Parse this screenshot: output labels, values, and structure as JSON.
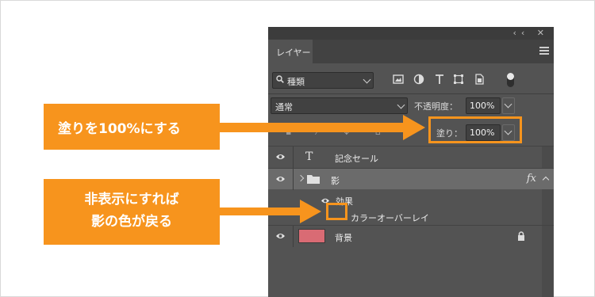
{
  "panel": {
    "tab_label": "レイヤー",
    "top_icons": "‹‹ ✕"
  },
  "filter": {
    "kind_label": "種類"
  },
  "blend": {
    "mode": "通常",
    "opacity_label": "不透明度：",
    "opacity_value": "100%",
    "fill_label": "塗り：",
    "fill_value": "100%"
  },
  "layers": [
    {
      "name": "記念セール",
      "type": "text",
      "visible": true
    },
    {
      "name": "影",
      "type": "group",
      "visible": true,
      "has_effects": true,
      "effects_badge": "fx"
    },
    {
      "name": "背景",
      "type": "background",
      "visible": true,
      "locked": true,
      "thumb_color": "#d96b74"
    }
  ],
  "effects": {
    "header": "効果",
    "items": [
      {
        "name": "カラーオーバーレイ",
        "visible": false
      }
    ]
  },
  "callouts": {
    "fill_note": "塗りを100%にする",
    "hide_note_line1": "非表示にすれば",
    "hide_note_line2": "影の色が戻る"
  },
  "colors": {
    "accent": "#f7941d",
    "panel_bg": "#535353",
    "selected_row": "#6b6b6b",
    "swatch": "#d96b74"
  }
}
